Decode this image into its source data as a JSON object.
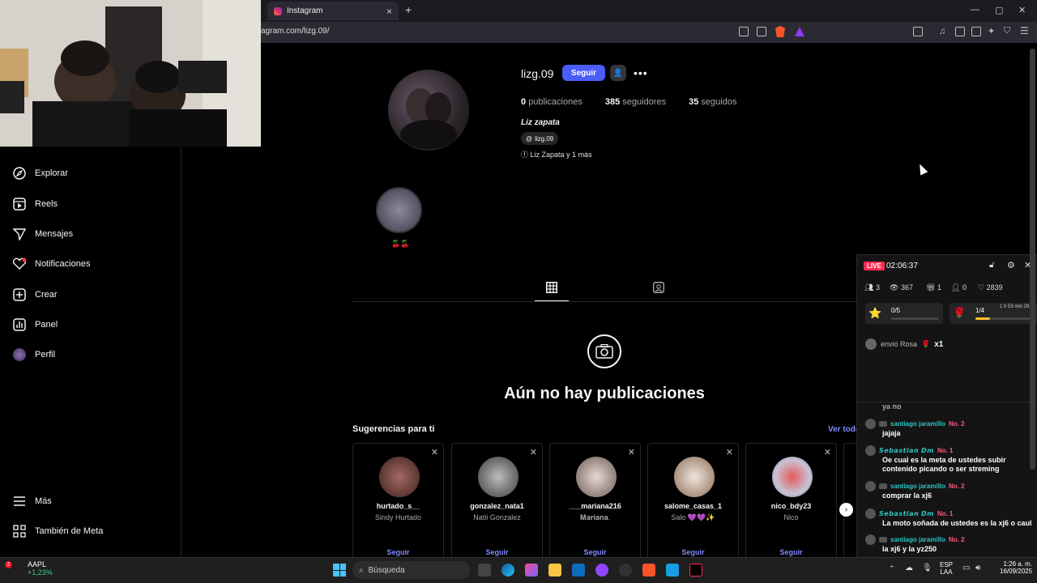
{
  "browser": {
    "tab_title": "Instagram",
    "tab_close": "×",
    "new_tab": "+",
    "url": "agram.com/lizg.09/",
    "window_controls": [
      "—",
      "▢",
      "✕"
    ]
  },
  "sidebar": {
    "items": [
      {
        "label": "Explorar",
        "icon": "compass-icon"
      },
      {
        "label": "Reels",
        "icon": "reels-icon"
      },
      {
        "label": "Mensajes",
        "icon": "send-icon"
      },
      {
        "label": "Notificaciones",
        "icon": "heart-icon"
      },
      {
        "label": "Crear",
        "icon": "plus-square-icon"
      },
      {
        "label": "Panel",
        "icon": "bar-chart-icon"
      },
      {
        "label": "Perfil",
        "icon": "avatar-icon"
      }
    ],
    "bottom": [
      {
        "label": "Más",
        "icon": "menu-icon"
      },
      {
        "label": "También de Meta",
        "icon": "meta-grid-icon"
      }
    ]
  },
  "profile": {
    "username": "lizg.09",
    "follow_label": "Seguir",
    "more_label": "•••",
    "posts_count": "0",
    "posts_label": "publicaciones",
    "followers_count": "385",
    "followers_label": "seguidores",
    "following_count": "35",
    "following_label": "seguidos",
    "full_name": "Liz zapata",
    "threads_handle": "lizg.09",
    "linked_accounts": "Liz Zapata y 1 más",
    "highlight_label": "🍒🍒"
  },
  "content": {
    "empty_title": "Aún no hay publicaciones"
  },
  "suggestions": {
    "title": "Sugerencias para ti",
    "see_all": "Ver todo",
    "follow_label": "Seguir",
    "close": "✕",
    "cards": [
      {
        "username": "hurtado_s__",
        "name": "Sindy Hurtado",
        "color": "#7a4a48"
      },
      {
        "username": "gonzalez_nata1",
        "name": "Natii Gonzalez",
        "color": "#9c9c9c"
      },
      {
        "username": "___mariana216",
        "name": "𝐌𝐚𝐫𝐢𝐚𝐧𝐚.",
        "color": "#cfc3c0"
      },
      {
        "username": "salome_casas_1",
        "name": "Salo 💜💜✨",
        "color": "#d8cfc8"
      },
      {
        "username": "nico_bdy23",
        "name": "Nico",
        "color": "#c9c3d6"
      }
    ],
    "next": "›"
  },
  "live": {
    "badge": "LIVE",
    "time": "02:06:37",
    "stats": {
      "viewers": "3",
      "views": "367",
      "gifts": "1",
      "follows": "0",
      "likes": "2839"
    },
    "goal1": {
      "label": "0/5",
      "progress": 0
    },
    "goal2": {
      "label": "1/4",
      "timer": "1 h 53 min 29 s",
      "progress": 0.25
    },
    "gift": {
      "text": "envió Rosa",
      "emoji": "🌹",
      "count": "x1"
    },
    "chat": [
      {
        "name": "",
        "rank": "",
        "msg": "ya no"
      },
      {
        "name": "santiago jaramillo",
        "rank": "No. 2",
        "msg": "jajaja"
      },
      {
        "name": "𝙎𝙚𝙗𝙖𝙨𝙩𝙞𝙖𝙣 𝘿𝙢",
        "rank": "No. 1",
        "msg": "Oe cual es la meta de ustedes subir contenido picando o ser streming"
      },
      {
        "name": "santiago jaramillo",
        "rank": "No. 2",
        "msg": "comprar la xj6"
      },
      {
        "name": "𝙎𝙚𝙗𝙖𝙨𝙩𝙞𝙖𝙣 𝘿𝙢",
        "rank": "No. 1",
        "msg": "La moto soñada de ustedes es la xj6 o caul"
      },
      {
        "name": "santiago jaramillo",
        "rank": "No. 2",
        "msg": "la xj6 y la yz250"
      }
    ]
  },
  "taskbar": {
    "stock_name": "AAPL",
    "stock_change": "+1,23%",
    "stock_badge": "2",
    "search_placeholder": "Búsqueda",
    "lang": "ESP",
    "lang2": "LAA",
    "time": "1:26 a. m.",
    "date": "16/09/2025"
  }
}
